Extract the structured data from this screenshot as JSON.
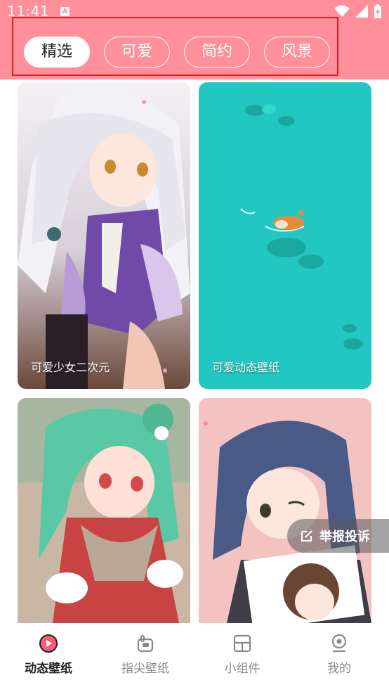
{
  "status_bar": {
    "time": "11:41",
    "badge": "A"
  },
  "tabs": [
    {
      "label": "精选",
      "active": true
    },
    {
      "label": "可爱",
      "active": false
    },
    {
      "label": "简约",
      "active": false
    },
    {
      "label": "风景",
      "active": false
    }
  ],
  "cards": [
    {
      "caption": "可爱少女二次元"
    },
    {
      "caption": "可爱动态壁纸"
    },
    {
      "caption": ""
    },
    {
      "caption": ""
    }
  ],
  "report_button": {
    "label": "举报投诉"
  },
  "bottom_nav": [
    {
      "label": "动态壁纸",
      "icon": "play-circle-icon",
      "active": true
    },
    {
      "label": "指尖壁纸",
      "icon": "hand-icon",
      "active": false
    },
    {
      "label": "小组件",
      "icon": "widget-icon",
      "active": false
    },
    {
      "label": "我的",
      "icon": "profile-icon",
      "active": false
    }
  ],
  "colors": {
    "header": "#ff8f9a",
    "accent": "#ff5a7a",
    "tab_outline_highlight": "#e01822"
  }
}
